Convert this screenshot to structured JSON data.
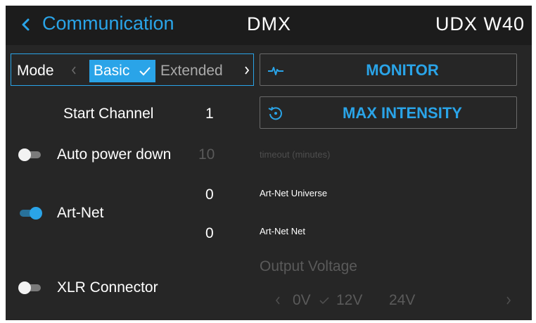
{
  "header": {
    "back_label": "Communication",
    "center_title": "DMX",
    "right_title": "UDX W40"
  },
  "mode": {
    "label": "Mode",
    "selected": "Basic",
    "other": "Extended"
  },
  "buttons": {
    "monitor": "MONITOR",
    "max_intensity": "MAX INTENSITY"
  },
  "settings": {
    "start_channel_label": "Start Channel",
    "start_channel_value": "1",
    "auto_power_down_label": "Auto power down",
    "auto_power_down_value": "10",
    "auto_power_down_enabled": false,
    "timeout_label": "timeout (minutes)",
    "art_net_label": "Art-Net",
    "art_net_enabled": true,
    "art_net_universe_value": "0",
    "art_net_universe_label": "Art-Net Universe",
    "art_net_net_value": "0",
    "art_net_net_label": "Art-Net Net",
    "xlr_label": "XLR Connector",
    "xlr_enabled": false
  },
  "output_voltage": {
    "label": "Output Voltage",
    "options": [
      "0V",
      "12V",
      "24V"
    ],
    "selected": "0V"
  },
  "colors": {
    "accent": "#2aa4e8",
    "background": "#262626",
    "header_background": "#1c1c1c",
    "disabled_text": "#5a5a5a"
  }
}
